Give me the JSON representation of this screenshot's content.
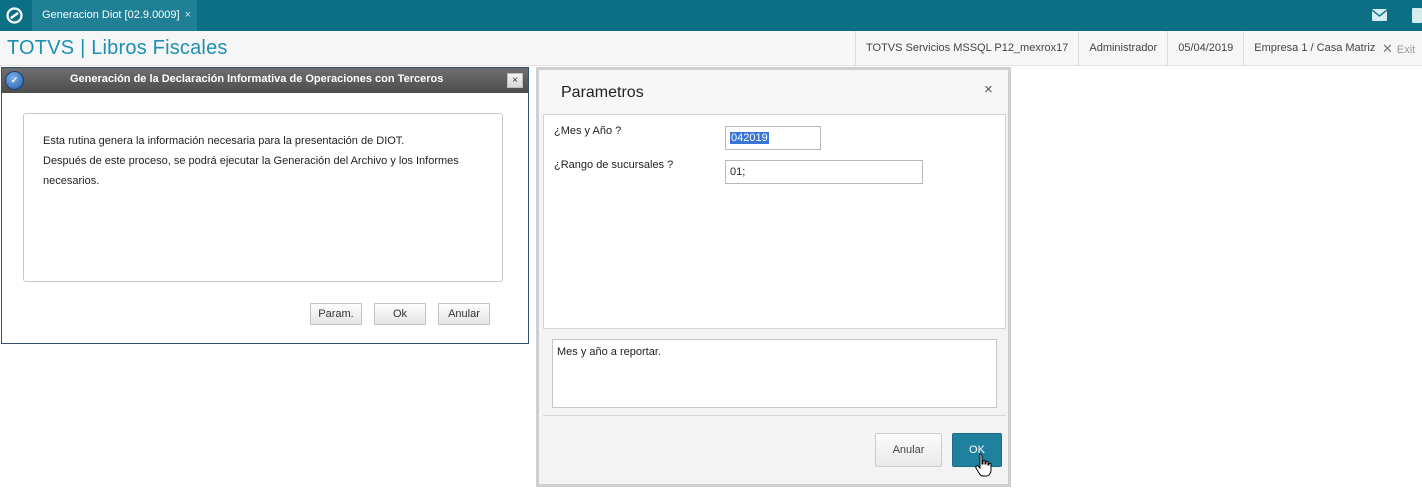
{
  "topbar": {
    "tab_label": "Generacion Diot [02.9.0009]",
    "tab_close": "×",
    "icons": [
      "totvs-logo-icon",
      "mail-icon",
      "notification-icon"
    ]
  },
  "appbar": {
    "title": "TOTVS | Libros Fiscales",
    "server": "TOTVS Servicios MSSQL P12_mexrox17",
    "user": "Administrador",
    "date": "05/04/2019",
    "company": "Empresa 1 / Casa Matriz",
    "exit_label": "Exit"
  },
  "left_dialog": {
    "title": "Generación de la Declaración Informativa de Operaciones con Terceros",
    "close": "×",
    "line1": "Esta rutina genera la información necesaria para la presentación de  DIOT.",
    "line2": "Después de este proceso, se podrá ejecutar la Generación del Archivo y los Informes",
    "line3": "necesarios.",
    "buttons": {
      "param": "Param.",
      "ok": "Ok",
      "cancel": "Anular"
    }
  },
  "param_dialog": {
    "title": "Parametros",
    "close": "×",
    "field1_label": "¿Mes y Año ?",
    "field1_value": "042019",
    "field2_label": "¿Rango de sucursales ?",
    "field2_value": "01;",
    "help_text": "Mes y año a reportar.",
    "buttons": {
      "cancel": "Anular",
      "ok": "OK"
    }
  },
  "colors": {
    "topbar": "#0b6f86",
    "title_accent": "#1b8fb4",
    "ok_button": "#20819f",
    "selection": "#3875d7"
  }
}
